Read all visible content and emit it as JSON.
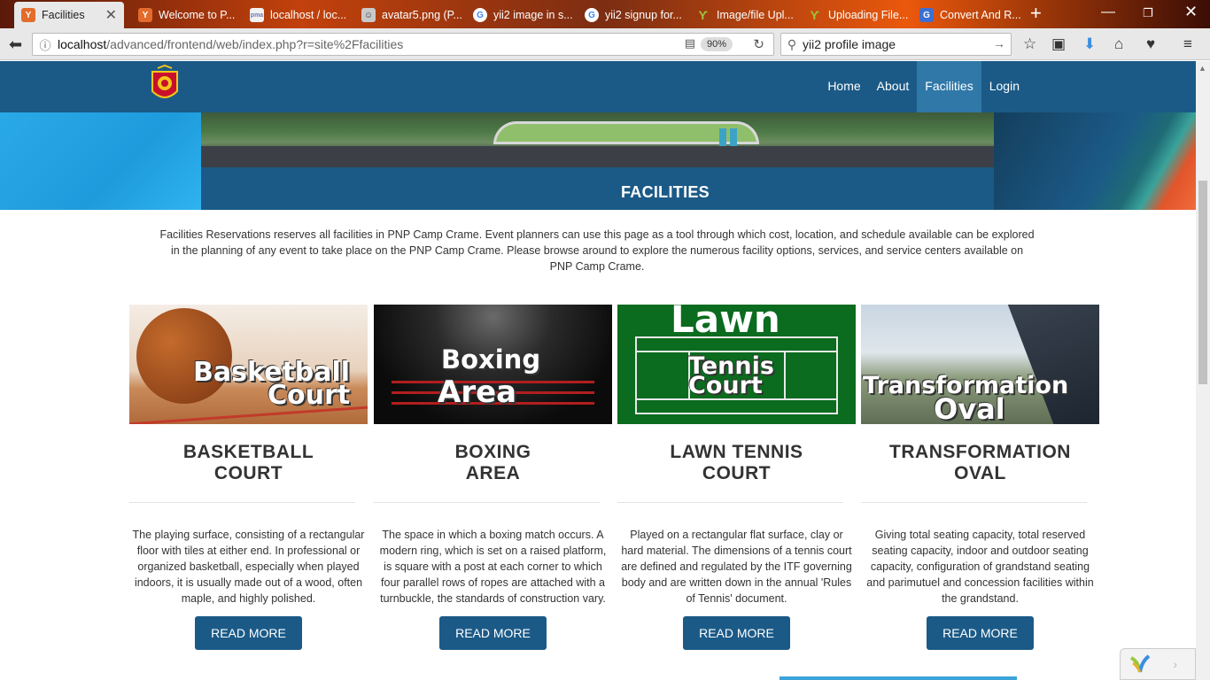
{
  "browser": {
    "tabs": [
      {
        "label": "Facilities",
        "icon": "yii-icon",
        "active": true
      },
      {
        "label": "Welcome to P...",
        "icon": "yii-icon"
      },
      {
        "label": "localhost / loc...",
        "icon": "phpmyadmin-icon"
      },
      {
        "label": "avatar5.png (P...",
        "icon": "avatar-icon"
      },
      {
        "label": "yii2 image in s...",
        "icon": "google-icon"
      },
      {
        "label": "yii2 signup for...",
        "icon": "google-icon"
      },
      {
        "label": "Image/file Upl...",
        "icon": "yii-bird-icon"
      },
      {
        "label": "Uploading File...",
        "icon": "yii-bird-icon"
      },
      {
        "label": "Convert And R...",
        "icon": "google-g-icon"
      }
    ],
    "url_host": "localhost",
    "url_path": "/advanced/frontend/web/index.php?r=site%2Ffacilities",
    "zoom": "90%",
    "search": "yii2 profile image"
  },
  "site": {
    "menu": [
      {
        "label": "Home"
      },
      {
        "label": "About"
      },
      {
        "label": "Facilities",
        "active": true
      },
      {
        "label": "Login"
      }
    ],
    "hero_title": "FACILITIES",
    "intro": "Facilities Reservations reserves all facilities in PNP Camp Crame. Event planners can use this page as a tool through which cost, location, and schedule available can be explored in the planning of any event to take place on the PNP Camp Crame. Please browse around to explore the numerous facility options, services, and service centers available on PNP Camp Crame.",
    "cards": [
      {
        "thumb_line1": "Basketball",
        "thumb_line2": "Court",
        "title_line1": "BASKETBALL",
        "title_line2": "COURT",
        "text": "The playing surface, consisting of a rectangular floor with tiles at either end. In professional or organized basketball, especially when played indoors, it is usually made out of a wood, often maple, and highly polished.",
        "button": "READ MORE"
      },
      {
        "thumb_line1": "Boxing",
        "thumb_line2": "Area",
        "title_line1": "BOXING",
        "title_line2": "AREA",
        "text": "The space in which a boxing match occurs. A modern ring, which is set on a raised platform, is square with a post at each corner to which four parallel rows of ropes are attached with a turnbuckle, the standards of construction vary.",
        "button": "READ MORE"
      },
      {
        "thumb_line1": "Lawn",
        "thumb_line2": "Tennis",
        "thumb_line3": "Court",
        "title_line1": "LAWN TENNIS",
        "title_line2": "COURT",
        "text": "Played on a rectangular flat surface, clay or hard material. The dimensions of a tennis court are defined and regulated by the ITF governing body and are written down in the annual 'Rules of Tennis' document.",
        "button": "READ MORE"
      },
      {
        "thumb_line1": "Transformation",
        "thumb_line2": "Oval",
        "title_line1": "TRANSFORMATION",
        "title_line2": "OVAL",
        "text": "Giving total seating capacity, total reserved seating capacity, indoor and outdoor seating capacity, configuration of grandstand seating and parimutuel and concession facilities within the grandstand.",
        "button": "READ MORE"
      }
    ]
  },
  "colors": {
    "brand": "#1b5a87",
    "nav_active": "#2f78a8",
    "tennis_green": "#0b6b1e"
  }
}
